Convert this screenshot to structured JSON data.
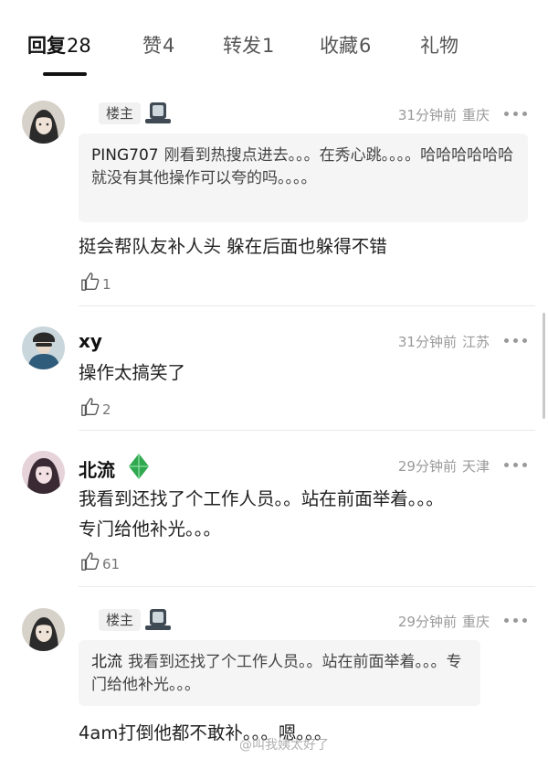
{
  "tabs": [
    {
      "label": "回复",
      "count": "28",
      "active": true
    },
    {
      "label": "赞",
      "count": "4"
    },
    {
      "label": "转发",
      "count": "1"
    },
    {
      "label": "收藏",
      "count": "6"
    },
    {
      "label": "礼物",
      "count": ""
    }
  ],
  "comments": [
    {
      "name": "",
      "tag": "楼主",
      "time": "31分钟前",
      "location": "重庆",
      "quote": {
        "name": "PING707",
        "text": "刚看到热搜点进去。。。在秀心跳。。。。哈哈哈哈哈哈就没有其他操作可以夸的吗。。。。"
      },
      "text": "挺会帮队友补人头 躲在后面也躲得不错",
      "likes": "1"
    },
    {
      "name": "xy",
      "time": "31分钟前",
      "location": "江苏",
      "text": "操作太搞笑了",
      "likes": "2"
    },
    {
      "name": "北流",
      "time": "29分钟前",
      "location": "天津",
      "text": "我看到还找了个工作人员。。站在前面举着。。。专门给他补光。。。",
      "likes": "61"
    },
    {
      "name": "",
      "tag": "楼主",
      "time": "29分钟前",
      "location": "重庆",
      "quote": {
        "name": "北流",
        "text": "我看到还找了个工作人员。。站在前面举着。。。专门给他补光。。。"
      },
      "text": "4am打倒他都不敢补。。。嗯。。。",
      "likes": ""
    }
  ],
  "watermark": "@叫我姨太好了",
  "colors": {
    "accent": "#111111",
    "meta": "#9a9a9a",
    "quote_bg": "#f5f5f5",
    "leaf_badge": "#2fa84f"
  }
}
